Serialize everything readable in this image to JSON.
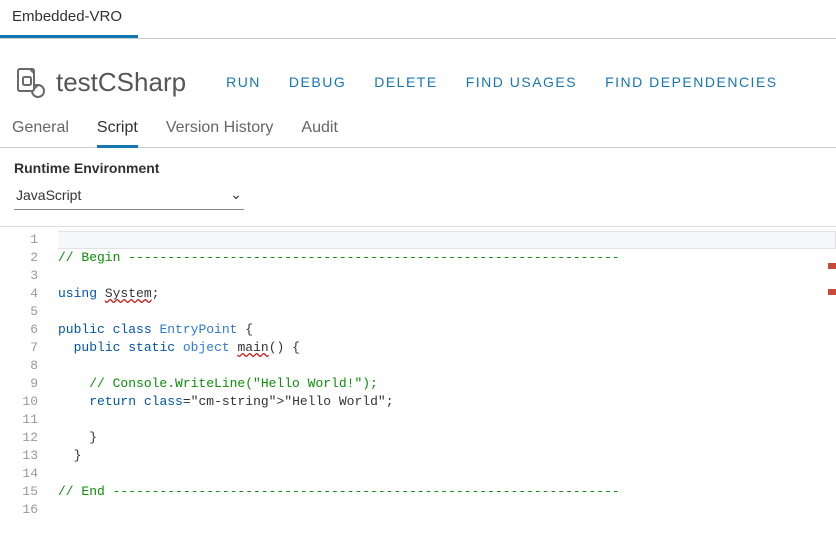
{
  "mainTabs": {
    "items": [
      "Embedded-VRO"
    ],
    "active": 0
  },
  "header": {
    "title": "testCSharp",
    "actions": [
      "RUN",
      "DEBUG",
      "DELETE",
      "FIND USAGES",
      "FIND DEPENDENCIES"
    ]
  },
  "subTabs": {
    "items": [
      "General",
      "Script",
      "Version History",
      "Audit"
    ],
    "active": 1
  },
  "runtime": {
    "label": "Runtime Environment",
    "selected": "JavaScript"
  },
  "code": {
    "lines": [
      "",
      "// Begin ---------------------------------------------------------------",
      "",
      "using System;",
      "",
      "public class EntryPoint {",
      "  public static object main() {",
      "",
      "    // Console.WriteLine(\"Hello World!\");",
      "    return \"Hello World\";",
      "",
      "    }",
      "  }",
      "",
      "// End -----------------------------------------------------------------",
      ""
    ],
    "errors": [
      "System",
      "main"
    ]
  }
}
